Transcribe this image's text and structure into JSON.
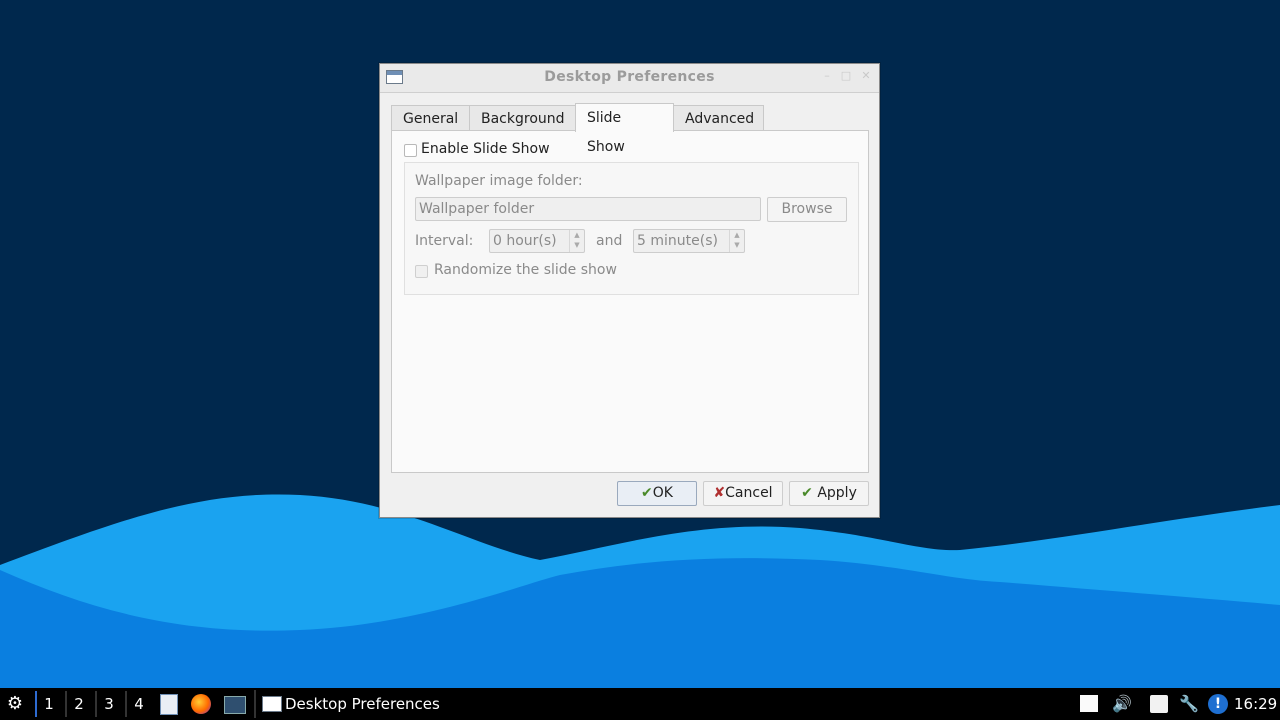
{
  "window": {
    "title": "Desktop Preferences"
  },
  "tabs": [
    {
      "label": "General"
    },
    {
      "label": "Background"
    },
    {
      "label": "Slide Show"
    },
    {
      "label": "Advanced"
    }
  ],
  "slideshow": {
    "enable_label": "Enable Slide Show",
    "folder_label": "Wallpaper image folder:",
    "folder_placeholder": "Wallpaper folder",
    "browse_label": "Browse",
    "interval_label": "Interval:",
    "hours_value": "0 hour(s)",
    "and_label": "and",
    "minutes_value": "5 minute(s)",
    "randomize_label": "Randomize the slide show"
  },
  "buttons": {
    "ok": "OK",
    "cancel": "Cancel",
    "apply": "Apply"
  },
  "taskbar": {
    "workspaces": [
      "1",
      "2",
      "3",
      "4"
    ],
    "task_label": "Desktop Preferences",
    "clock": "16:29"
  },
  "colors": {
    "desktop_bg": "#00284d",
    "wave_light": "#1aa3f0",
    "wave_mid": "#0b86e6"
  }
}
